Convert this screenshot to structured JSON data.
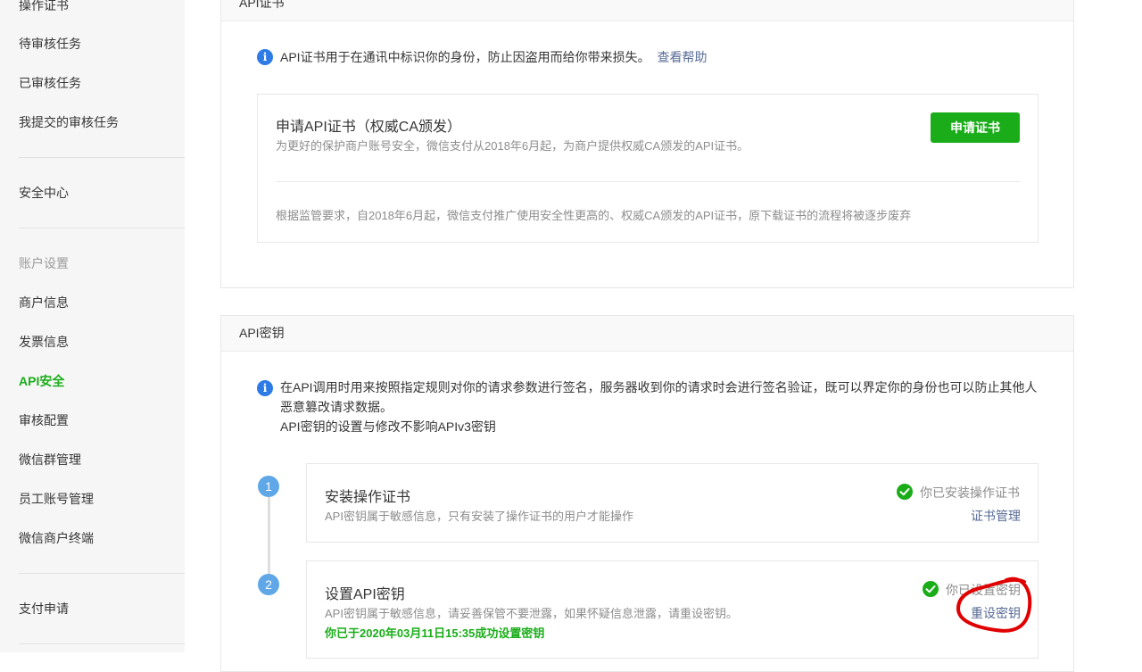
{
  "sidebar": {
    "items_top": [
      "操作证书",
      "待审核任务",
      "已审核任务",
      "我提交的审核任务"
    ],
    "security_center": "安全中心",
    "account_group": "账户设置",
    "account_items": [
      "商户信息",
      "发票信息",
      "API安全",
      "审核配置",
      "微信群管理",
      "员工账号管理",
      "微信商户终端"
    ],
    "active_item": "API安全",
    "pay_apply": "支付申请"
  },
  "cert_panel": {
    "title": "API证书",
    "info": "API证书用于在通讯中标识你的身份，防止因盗用而给你带来损失。",
    "help_link": "查看帮助",
    "apply_title": "申请API证书（权威CA颁发）",
    "apply_desc": "为更好的保护商户账号安全，微信支付从2018年6月起，为商户提供权威CA颁发的API证书。",
    "apply_button": "申请证书",
    "notice": "根据监管要求，自2018年6月起，微信支付推广使用安全性更高的、权威CA颁发的API证书，原下载证书的流程将被逐步废弃"
  },
  "key_panel": {
    "title": "API密钥",
    "info_line1": "在API调用时用来按照指定规则对你的请求参数进行签名，服务器收到你的请求时会进行签名验证，既可以界定你的身份也可以防止其他人",
    "info_line2": "恶意篡改请求数据。",
    "info_line3": "API密钥的设置与修改不影响APIv3密钥",
    "steps": [
      {
        "number": "1",
        "title": "安装操作证书",
        "desc": "API密钥属于敏感信息，只有安装了操作证书的用户才能操作",
        "status": "你已安装操作证书",
        "action": "证书管理"
      },
      {
        "number": "2",
        "title": "设置API密钥",
        "desc": "API密钥属于敏感信息，请妥善保管不要泄露，如果怀疑信息泄露，请重设密钥。",
        "status": "你已设置密钥",
        "action": "重设密钥",
        "note": "你已于2020年03月11日15:35成功设置密钥"
      }
    ]
  },
  "colors": {
    "accent": "#1aad19",
    "link": "#576b95",
    "info": "#2e7be5",
    "step": "#5fa7e7",
    "highlight_circle": "#e00000"
  }
}
